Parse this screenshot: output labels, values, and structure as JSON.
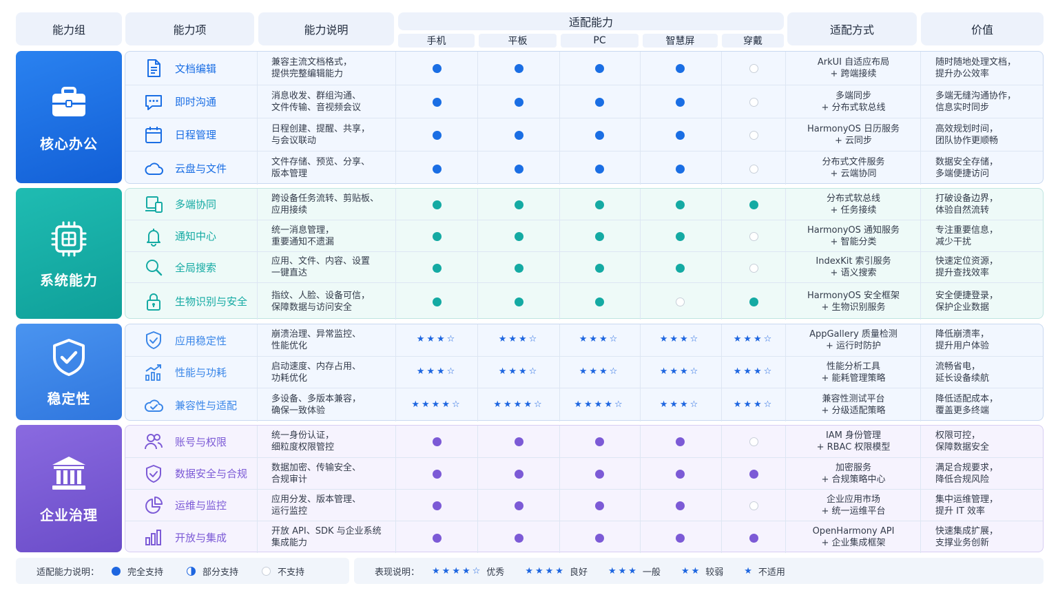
{
  "header": {
    "group": "能力组",
    "item": "能力项",
    "desc": "能力说明",
    "adapt": "适配能力",
    "devices": [
      "手机",
      "平板",
      "PC",
      "智慧屏",
      "穿戴"
    ],
    "method": "适配方式",
    "value": "价值"
  },
  "colors": {
    "core": "#1a6ee4",
    "system": "#14aaa3",
    "stability": "#3a86e8",
    "enterprise": "#7c5ad6",
    "star": "#1e66e0"
  },
  "groups": [
    {
      "title": "核心办公",
      "icon": "briefcase-icon",
      "items": [
        {
          "name": "文档编辑",
          "icon": "document-icon",
          "desc": "兼容主流文档格式，\n提供完整编辑能力",
          "support": [
            "full",
            "full",
            "full",
            "full",
            "none"
          ],
          "method": "ArkUI 自适应布局\n+ 跨端接续",
          "value": "随时随地处理文档，\n提升办公效率"
        },
        {
          "name": "即时沟通",
          "icon": "chat-icon",
          "desc": "消息收发、群组沟通、\n文件传输、音视频会议",
          "support": [
            "full",
            "full",
            "full",
            "full",
            "none"
          ],
          "method": "多端同步\n+ 分布式软总线",
          "value": "多端无缝沟通协作，\n信息实时同步"
        },
        {
          "name": "日程管理",
          "icon": "calendar-icon",
          "desc": "日程创建、提醒、共享，\n与会议联动",
          "support": [
            "full",
            "full",
            "full",
            "full",
            "none"
          ],
          "method": "HarmonyOS 日历服务\n+ 云同步",
          "value": "高效规划时间，\n团队协作更顺畅"
        },
        {
          "name": "云盘与文件",
          "icon": "cloud-icon",
          "desc": "文件存储、预览、分享、\n版本管理",
          "support": [
            "full",
            "full",
            "full",
            "full",
            "none"
          ],
          "method": "分布式文件服务\n+ 云端协同",
          "value": "数据安全存储，\n多端便捷访问"
        }
      ]
    },
    {
      "title": "系统能力",
      "icon": "chip-icon",
      "items": [
        {
          "name": "多端协同",
          "icon": "devices-icon",
          "desc": "跨设备任务流转、剪贴板、\n应用接续",
          "support": [
            "full",
            "full",
            "full",
            "full",
            "full"
          ],
          "method": "分布式软总线\n+ 任务接续",
          "value": "打破设备边界，\n体验自然流转"
        },
        {
          "name": "通知中心",
          "icon": "bell-icon",
          "desc": "统一消息管理，\n重要通知不遗漏",
          "support": [
            "full",
            "full",
            "full",
            "full",
            "none"
          ],
          "method": "HarmonyOS 通知服务\n+ 智能分类",
          "value": "专注重要信息，\n减少干扰"
        },
        {
          "name": "全局搜索",
          "icon": "search-icon",
          "desc": "应用、文件、内容、设置\n一键直达",
          "support": [
            "full",
            "full",
            "full",
            "full",
            "none"
          ],
          "method": "IndexKit 索引服务\n+ 语义搜索",
          "value": "快速定位资源，\n提升查找效率"
        },
        {
          "name": "生物识别与安全",
          "icon": "lock-icon",
          "desc": "指纹、人脸、设备可信，\n保障数据与访问安全",
          "support": [
            "full",
            "full",
            "full",
            "none",
            "full"
          ],
          "method": "HarmonyOS 安全框架\n+ 生物识别服务",
          "value": "安全便捷登录，\n保护企业数据"
        }
      ]
    },
    {
      "title": "稳定性",
      "icon": "shield-check-icon",
      "items": [
        {
          "name": "应用稳定性",
          "icon": "shield-icon",
          "desc": "崩溃治理、异常监控、\n性能优化",
          "stars": [
            [
              3,
              1
            ],
            [
              3,
              1
            ],
            [
              3,
              1
            ],
            [
              3,
              1
            ],
            [
              3,
              1
            ]
          ],
          "method": "AppGallery 质量检测\n+ 运行时防护",
          "value": "降低崩溃率，\n提升用户体验"
        },
        {
          "name": "性能与功耗",
          "icon": "performance-chart-icon",
          "desc": "启动速度、内存占用、\n功耗优化",
          "stars": [
            [
              3,
              1
            ],
            [
              3,
              1
            ],
            [
              3,
              1
            ],
            [
              3,
              1
            ],
            [
              3,
              1
            ]
          ],
          "method": "性能分析工具\n+ 能耗管理策略",
          "value": "流畅省电，\n延长设备续航"
        },
        {
          "name": "兼容性与适配",
          "icon": "cloud-check-icon",
          "desc": "多设备、多版本兼容，\n确保一致体验",
          "stars": [
            [
              4,
              1
            ],
            [
              4,
              1
            ],
            [
              4,
              1
            ],
            [
              3,
              1
            ],
            [
              3,
              1
            ]
          ],
          "method": "兼容性测试平台\n+ 分级适配策略",
          "value": "降低适配成本，\n覆盖更多终端"
        }
      ]
    },
    {
      "title": "企业治理",
      "icon": "institution-icon",
      "items": [
        {
          "name": "账号与权限",
          "icon": "users-icon",
          "desc": "统一身份认证，\n细粒度权限管控",
          "support": [
            "full",
            "full",
            "full",
            "full",
            "none"
          ],
          "method": "IAM 身份管理\n+ RBAC 权限模型",
          "value": "权限可控，\n保障数据安全"
        },
        {
          "name": "数据安全与合规",
          "icon": "shield-icon",
          "desc": "数据加密、传输安全、\n合规审计",
          "support": [
            "full",
            "full",
            "full",
            "full",
            "full"
          ],
          "method": "加密服务\n+ 合规策略中心",
          "value": "满足合规要求，\n降低合规风险"
        },
        {
          "name": "运维与监控",
          "icon": "pie-chart-icon",
          "desc": "应用分发、版本管理、\n运行监控",
          "support": [
            "full",
            "full",
            "full",
            "full",
            "none"
          ],
          "method": "企业应用市场\n+ 统一运维平台",
          "value": "集中运维管理，\n提升 IT 效率"
        },
        {
          "name": "开放与集成",
          "icon": "bar-chart-icon",
          "desc": "开放 API、SDK 与企业系统\n集成能力",
          "support": [
            "full",
            "full",
            "full",
            "full",
            "full"
          ],
          "method": "OpenHarmony API\n+ 企业集成框架",
          "value": "快速集成扩展，\n支撑业务创新"
        }
      ]
    }
  ],
  "legend": {
    "support_label": "适配能力说明：",
    "support_items": [
      {
        "kind": "full",
        "label": "完全支持"
      },
      {
        "kind": "partial",
        "label": "部分支持"
      },
      {
        "kind": "none",
        "label": "不支持"
      }
    ],
    "perf_label": "表现说明：",
    "perf_items": [
      {
        "stars": "★★★★☆",
        "label": "优秀"
      },
      {
        "stars": "★★★★",
        "label": "良好"
      },
      {
        "stars": "★★★",
        "label": "一般"
      },
      {
        "stars": "★★",
        "label": "较弱"
      },
      {
        "stars": "★",
        "label": "不适用"
      }
    ]
  }
}
